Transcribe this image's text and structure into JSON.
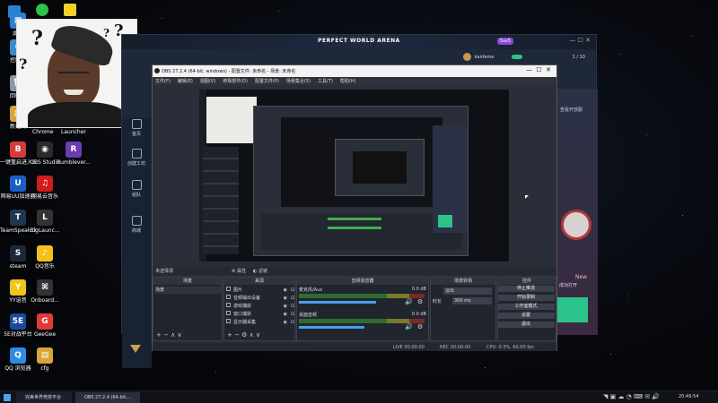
{
  "desktop_icons": [
    {
      "label": "此电",
      "color": "#2d7fd3",
      "glyph": "▦"
    },
    {
      "label": "控制面",
      "color": "#3b89c7",
      "glyph": "⚙"
    },
    {
      "label": "回收站",
      "color": "#8a97a8",
      "glyph": "🗑"
    },
    {
      "label": "新建文",
      "color": "#d6a43a",
      "glyph": "▤"
    },
    {
      "label": "一键重启进入BIOS",
      "color": "#d23c3c",
      "glyph": "B"
    },
    {
      "label": "OBS Studio",
      "color": "#2a2a2a",
      "glyph": "◉"
    },
    {
      "label": "Rumblever...",
      "color": "#6a3db0",
      "glyph": "R"
    },
    {
      "label": "网易UU加速器",
      "color": "#1b5fc6",
      "glyph": "U"
    },
    {
      "label": "网易云音乐",
      "color": "#d01c1c",
      "glyph": "♫"
    },
    {
      "label": "TeamSpeak 3",
      "color": "#1f3650",
      "glyph": "T"
    },
    {
      "label": "BigLaunc...",
      "color": "#333",
      "glyph": "L"
    },
    {
      "label": "steam",
      "color": "#1b2838",
      "glyph": "S"
    },
    {
      "label": "QQ音乐",
      "color": "#f3c11b",
      "glyph": "♪"
    },
    {
      "label": "YY语音",
      "color": "#f0c419",
      "glyph": "Y"
    },
    {
      "label": "Onboard...",
      "color": "#333",
      "glyph": "⌘"
    },
    {
      "label": "5E对战平台",
      "color": "#1a4a9c",
      "glyph": "5E"
    },
    {
      "label": "GeeGee",
      "color": "#e23a3a",
      "glyph": "G"
    },
    {
      "label": "QQ 浏览器",
      "color": "#2e8be0",
      "glyph": "Q"
    },
    {
      "label": "cfg",
      "color": "#d8a53a",
      "glyph": "▤"
    }
  ],
  "top_icons": [
    {
      "label": "Chrome"
    },
    {
      "label": "Launcher"
    }
  ],
  "arena": {
    "title": "PERFECT WORLD ARENA",
    "username": "kanfame",
    "badge": "5vs5",
    "side_items": [
      "首页",
      "创建工坊",
      "组队",
      "商城"
    ],
    "right_text": "查看开放服",
    "new_label": "New",
    "page": "1 / 10",
    "bottom_note": "成功打开"
  },
  "obs": {
    "title": "OBS 27.2.4 (64-bit, windows) - 配置文件: 未命名 - 场景: 未命名",
    "menu": [
      "文件(F)",
      "编辑(E)",
      "视图(V)",
      "停靠部件(D)",
      "配置文件(P)",
      "场景集合(S)",
      "工具(T)",
      "帮助(H)"
    ],
    "no_source": "未选择源",
    "props_btn": "属性",
    "filters_btn": "滤镜",
    "docks": {
      "scenes": "场景",
      "sources": "来源",
      "mixer": "音频混音器",
      "transitions": "场景转场",
      "controls": "控件"
    },
    "scene_items": [
      "场景"
    ],
    "sources": [
      "图片",
      "音频输出设备",
      "游戏捕获",
      "窗口捕获",
      "显示器采集"
    ],
    "mixer": [
      {
        "name": "麦克风/Aux",
        "db": "0.0 dB",
        "level": 0.78
      },
      {
        "name": "桌面音频",
        "db": "0.0 dB",
        "level": 0.66
      }
    ],
    "transition": "淡出",
    "duration_label": "时长",
    "duration": "300 ms",
    "controls": [
      "停止推流",
      "开始录制",
      "工作室模式",
      "设置",
      "退出"
    ],
    "status": {
      "dropped": "LIVE",
      "live_time": "00:00:00",
      "rec": "REC",
      "rec_time": "00:00:00",
      "cpu": "CPU: 0.3%, 60.00 fps"
    }
  },
  "taskbar": {
    "items": [
      "完美世界竞技平台",
      "OBS 27.2.4 (64-bit,..."
    ],
    "clock": "20:49:54"
  },
  "colors": {
    "accent_purple": "#8a4ad6",
    "live_green": "#2bc48a"
  }
}
